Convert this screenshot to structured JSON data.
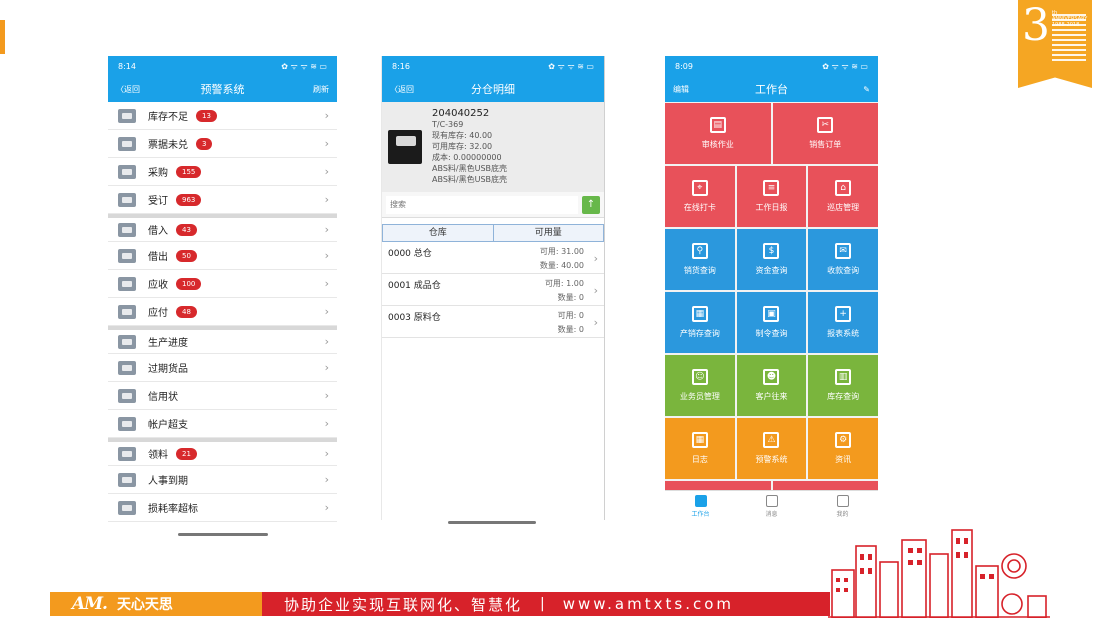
{
  "phone1": {
    "status_time": "8:14",
    "status_right": "✿ ᯤ ᯤ ≋ ▭",
    "nav_back": "〈返回",
    "nav_title": "预警系统",
    "nav_right": "刷新",
    "items": [
      {
        "label": "库存不足",
        "badge": "13",
        "gap": false
      },
      {
        "label": "票据未兑",
        "badge": "3",
        "gap": false
      },
      {
        "label": "采购",
        "badge": "155",
        "gap": false
      },
      {
        "label": "受订",
        "badge": "963",
        "gap": false
      },
      {
        "label": "借入",
        "badge": "43",
        "gap": true
      },
      {
        "label": "借出",
        "badge": "50",
        "gap": false
      },
      {
        "label": "应收",
        "badge": "100",
        "gap": false
      },
      {
        "label": "应付",
        "badge": "48",
        "gap": false
      },
      {
        "label": "生产进度",
        "badge": "",
        "gap": true
      },
      {
        "label": "过期货品",
        "badge": "",
        "gap": false
      },
      {
        "label": "信用状",
        "badge": "",
        "gap": false
      },
      {
        "label": "帐户超支",
        "badge": "",
        "gap": false
      },
      {
        "label": "领料",
        "badge": "21",
        "gap": true
      },
      {
        "label": "人事到期",
        "badge": "",
        "gap": false
      },
      {
        "label": "损耗率超标",
        "badge": "",
        "gap": false
      }
    ]
  },
  "phone2": {
    "status_time": "8:16",
    "status_right": "✿ ᯤ ᯤ ≋ ▭",
    "nav_back": "〈返回",
    "nav_title": "分仓明细",
    "product": {
      "code": "204040252",
      "spec": "T/C-369",
      "stock": "现有库存: 40.00",
      "available": "可用库存: 32.00",
      "cost": "成本: 0.00000000",
      "desc1": "ABS料/黑色USB底壳",
      "desc2": "ABS料/黑色USB底壳"
    },
    "search_placeholder": "搜索",
    "head_warehouse": "仓库",
    "head_available": "可用量",
    "rows": [
      {
        "warehouse": "0000  总仓",
        "avail": "可用: 31.00",
        "qty": "数量: 40.00"
      },
      {
        "warehouse": "0001  成品仓",
        "avail": "可用: 1.00",
        "qty": "数量: 0"
      },
      {
        "warehouse": "0003  原料仓",
        "avail": "可用: 0",
        "qty": "数量: 0"
      }
    ]
  },
  "phone3": {
    "status_time": "8:09",
    "status_right": "✿ ᯤ ᯤ ≋ ▭",
    "nav_left": "编辑",
    "nav_title": "工作台",
    "nav_right": "✎",
    "tiles": [
      {
        "label": "审核作业",
        "icon": "▤",
        "color": "#e8515a"
      },
      {
        "label": "销售订单",
        "icon": "✂",
        "color": "#e8515a"
      },
      {
        "label": "在线打卡",
        "icon": "⌖",
        "color": "#e8515a"
      },
      {
        "label": "工作日报",
        "icon": "≡",
        "color": "#e8515a"
      },
      {
        "label": "巡店管理",
        "icon": "⌂",
        "color": "#e8515a"
      },
      {
        "label": "销货查询",
        "icon": "⚲",
        "color": "#2b98dd"
      },
      {
        "label": "资金查询",
        "icon": "$",
        "color": "#2b98dd"
      },
      {
        "label": "收款查询",
        "icon": "✉",
        "color": "#2b98dd"
      },
      {
        "label": "产销存查询",
        "icon": "▦",
        "color": "#2b98dd"
      },
      {
        "label": "制令查询",
        "icon": "▣",
        "color": "#2b98dd"
      },
      {
        "label": "报表系统",
        "icon": "+",
        "color": "#2b98dd"
      },
      {
        "label": "业务员管理",
        "icon": "☺",
        "color": "#7ab53d"
      },
      {
        "label": "客户往来",
        "icon": "☻",
        "color": "#7ab53d"
      },
      {
        "label": "库存查询",
        "icon": "▥",
        "color": "#7ab53d"
      },
      {
        "label": "日志",
        "icon": "▦",
        "color": "#f39a1e"
      },
      {
        "label": "预警系统",
        "icon": "⚠",
        "color": "#f39a1e"
      },
      {
        "label": "资讯",
        "icon": "⚙",
        "color": "#f39a1e"
      }
    ],
    "tabs": [
      {
        "label": "工作台",
        "active": true
      },
      {
        "label": "消息",
        "active": false
      },
      {
        "label": "我的",
        "active": false
      }
    ]
  },
  "footer": {
    "logo_mark": "AM.",
    "logo_name": "天心天思",
    "slogan": "协助企业实现互联网化、智慧化",
    "separator": "|",
    "url": "www.amtxts.com"
  },
  "badge": {
    "number": "3",
    "small": "th ANNIVERSARY 1988-2018"
  }
}
